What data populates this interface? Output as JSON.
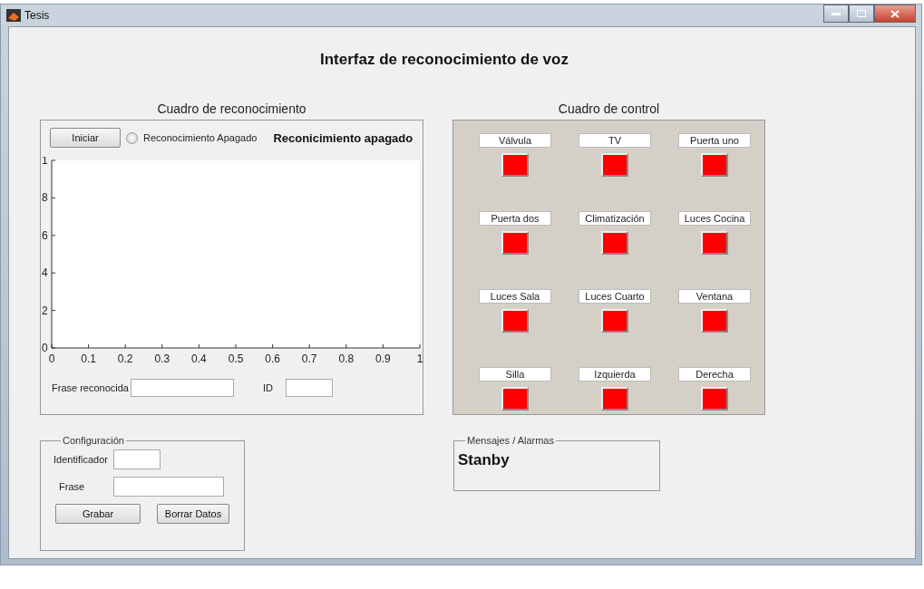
{
  "window": {
    "title": "Tesis"
  },
  "heading": "Interfaz de reconocimiento de voz",
  "recognition_panel": {
    "title": "Cuadro de reconocimiento",
    "start_button": "Iniciar",
    "radio": {
      "label": "Reconocimiento Apagado",
      "selected": false
    },
    "status": "Reconicimiento apagado",
    "plot": {
      "x_tick_labels": [
        "0",
        "0.1",
        "0.2",
        "0.3",
        "0.4",
        "0.5",
        "0.6",
        "0.7",
        "0.8",
        "0.9",
        "1"
      ],
      "y_tick_labels": [
        "1",
        "8",
        "6",
        "4",
        "2",
        "0"
      ]
    },
    "phrase_label": "Frase reconocida",
    "id_label": "ID"
  },
  "control_panel": {
    "title": "Cuadro de control",
    "devices": [
      {
        "label": "Válvula",
        "on": false
      },
      {
        "label": "TV",
        "on": false
      },
      {
        "label": "Puerta uno",
        "on": false
      },
      {
        "label": "Puerta dos",
        "on": false
      },
      {
        "label": "Climatización",
        "on": false
      },
      {
        "label": "Luces Cocina",
        "on": false
      },
      {
        "label": "Luces Sala",
        "on": false
      },
      {
        "label": "Luces Cuarto",
        "on": false
      },
      {
        "label": "Ventana",
        "on": false
      },
      {
        "label": "Silla",
        "on": false
      },
      {
        "label": "Izquierda",
        "on": false
      },
      {
        "label": "Derecha",
        "on": false
      }
    ]
  },
  "configuration": {
    "title": "Configuración",
    "identifier_label": "Identificador",
    "phrase_label": "Frase",
    "buttons": [
      "Grabar",
      "Borrar Datos"
    ]
  },
  "messages": {
    "title": "Mensajes / Alarmas",
    "text": "Stanby"
  }
}
